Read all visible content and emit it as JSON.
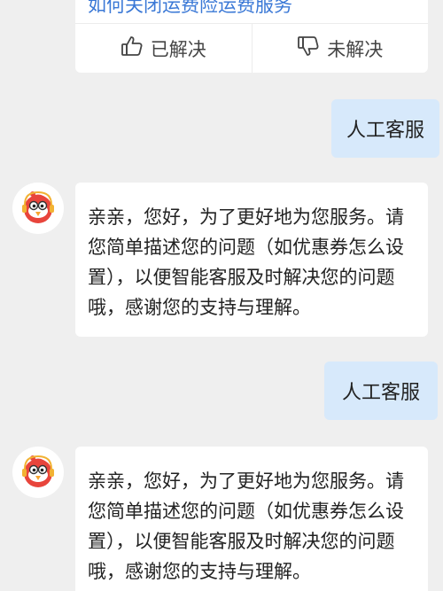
{
  "feedback": {
    "question_link": "如何关闭运费险运费服务",
    "solved_label": "已解决",
    "unsolved_label": "未解决"
  },
  "messages": [
    {
      "type": "user",
      "text": "人工客服"
    },
    {
      "type": "bot",
      "text": "亲亲，您好，为了更好地为您服务。请您简单描述您的问题（如优惠券怎么设置），以便智能客服及时解决您的问题哦，感谢您的支持与理解。"
    },
    {
      "type": "user",
      "text": "人工客服"
    },
    {
      "type": "bot",
      "text": "亲亲，您好，为了更好地为您服务。请您简单描述您的问题（如优惠券怎么设置），以便智能客服及时解决您的问题哦，感谢您的支持与理解。"
    }
  ],
  "colors": {
    "user_bubble": "#d7e9fb",
    "link": "#3a78d6",
    "avatar_red": "#e8453c"
  }
}
